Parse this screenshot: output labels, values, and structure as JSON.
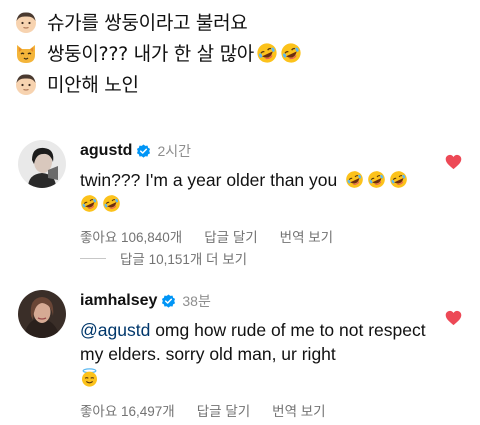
{
  "caption": {
    "lines": [
      {
        "emoji": "man-face-icon",
        "text": "슈가를 쌍둥이라고 불러요"
      },
      {
        "emoji": "cat-face-icon",
        "text": "쌍둥이??? 내가 한 살 많아",
        "trailing_emoji": [
          "rofl-emoji",
          "rofl-emoji"
        ]
      },
      {
        "emoji": "man-face-icon",
        "text": "미안해 노인"
      }
    ]
  },
  "comments": [
    {
      "username": "agustd",
      "verified": true,
      "time": "2시간",
      "text": "twin??? I'm a year older than you",
      "emojis": [
        "rofl-emoji",
        "rofl-emoji",
        "rofl-emoji",
        "rofl-emoji",
        "rofl-emoji"
      ],
      "likes": "좋아요 106,840개",
      "reply": "답글 달기",
      "translate": "번역 보기",
      "liked": true
    },
    {
      "username": "iamhalsey",
      "verified": true,
      "time": "38분",
      "mention": "@agustd",
      "text": "omg how rude of me to not respect my elders. sorry old man, ur right",
      "emojis": [
        "halo-smile-emoji"
      ],
      "likes": "좋아요 16,497개",
      "reply": "답글 달기",
      "translate": "번역 보기",
      "liked": true
    }
  ],
  "view_replies": "답글 10,151개 더 보기",
  "colors": {
    "heart": "#ed4956",
    "verified": "#0095f6",
    "muted": "#737373",
    "mention": "#00376b"
  }
}
